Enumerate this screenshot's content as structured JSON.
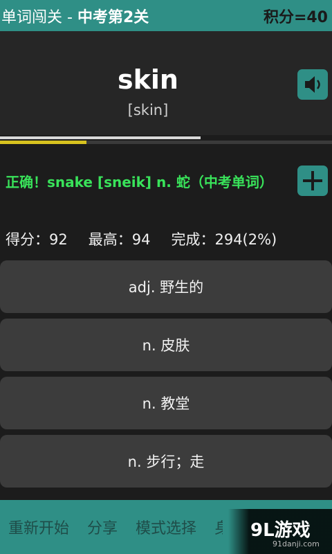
{
  "header": {
    "title_prefix": "单词闯关 - ",
    "title_level": "中考第2关",
    "points": "积分=40"
  },
  "word": {
    "text": "skin",
    "phonetic": "[skin]"
  },
  "progress": {
    "fraction": 0.26
  },
  "feedback": {
    "text": "正确！snake [sneik] n. 蛇（中考单词）"
  },
  "stats": {
    "score": "得分：92",
    "best": "最高：94",
    "done": "完成：294(2%)"
  },
  "options": [
    "adj. 野生的",
    "n. 皮肤",
    "n. 教堂",
    "n. 步行；走"
  ],
  "bottom": {
    "restart": "重新开始",
    "share": "分享",
    "mode": "模式选择",
    "truncated": "身"
  },
  "watermark": {
    "brand": "9L游戏",
    "url": "91danji.com"
  },
  "icons": {
    "speaker": "speaker-icon",
    "add": "plus-icon"
  },
  "colors": {
    "accent": "#2f8f86",
    "correct": "#39e35a",
    "progress": "#d7c21f"
  }
}
